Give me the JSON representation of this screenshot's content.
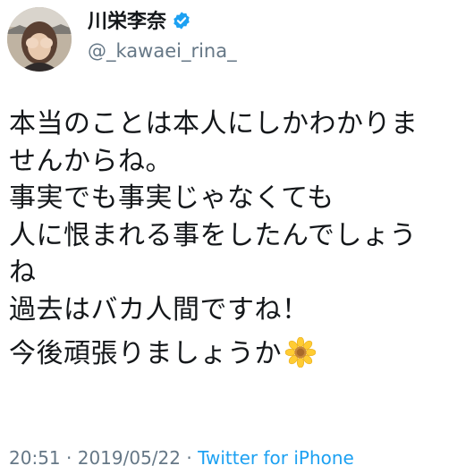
{
  "user": {
    "display_name": "川栄李奈",
    "handle": "@_kawaei_rina_",
    "verified_icon": "verified-badge-icon",
    "avatar_icon": "profile-photo"
  },
  "tweet": {
    "lines": [
      "本当のことは本人にしかわかりま",
      "せんからね。",
      "事実でも事実じゃなくても",
      "人に恨まれる事をしたんでしょう",
      "ね",
      "過去はバカ人間ですね！",
      "今後頑張りましょうか"
    ],
    "trailing_emoji": "sunflower-icon"
  },
  "meta": {
    "time": "20:51",
    "separator1": " · ",
    "date": "2019/05/22",
    "separator2": " · ",
    "source": "Twitter for iPhone"
  },
  "colors": {
    "text": "#14171a",
    "secondary": "#657786",
    "link": "#1da1f2",
    "verified": "#1da1f2"
  }
}
